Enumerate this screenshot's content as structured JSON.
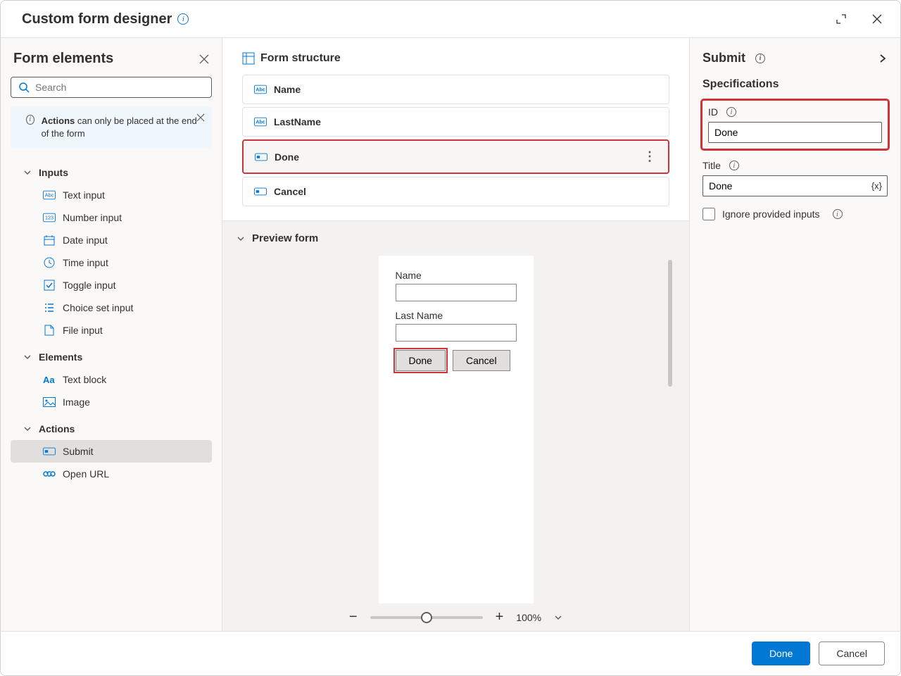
{
  "titlebar": {
    "title": "Custom form designer"
  },
  "sidebar_left": {
    "title": "Form elements",
    "search_placeholder": "Search",
    "notice_bold": "Actions",
    "notice_rest": " can only be placed at the end of the form",
    "groups": [
      {
        "label": "Inputs",
        "items": [
          {
            "label": "Text input",
            "icon": "abc"
          },
          {
            "label": "Number input",
            "icon": "123"
          },
          {
            "label": "Date input",
            "icon": "calendar"
          },
          {
            "label": "Time input",
            "icon": "clock"
          },
          {
            "label": "Toggle input",
            "icon": "check"
          },
          {
            "label": "Choice set input",
            "icon": "list"
          },
          {
            "label": "File input",
            "icon": "file"
          }
        ]
      },
      {
        "label": "Elements",
        "items": [
          {
            "label": "Text block",
            "icon": "Aa"
          },
          {
            "label": "Image",
            "icon": "image"
          }
        ]
      },
      {
        "label": "Actions",
        "items": [
          {
            "label": "Submit",
            "icon": "submit",
            "selected": true
          },
          {
            "label": "Open URL",
            "icon": "link"
          }
        ]
      }
    ]
  },
  "structure": {
    "title": "Form structure",
    "rows": [
      {
        "label": "Name",
        "icon": "abc"
      },
      {
        "label": "LastName",
        "icon": "abc"
      },
      {
        "label": "Done",
        "icon": "submit",
        "selected": true
      },
      {
        "label": "Cancel",
        "icon": "submit"
      }
    ]
  },
  "preview": {
    "title": "Preview form",
    "name_label": "Name",
    "lastname_label": "Last Name",
    "done_label": "Done",
    "cancel_label": "Cancel",
    "zoom": "100%"
  },
  "right": {
    "title": "Submit",
    "spec_title": "Specifications",
    "id_label": "ID",
    "id_value": "Done",
    "title_label": "Title",
    "title_value": "Done",
    "fx_badge": "{x}",
    "ignore_label": "Ignore provided inputs"
  },
  "footer": {
    "done": "Done",
    "cancel": "Cancel"
  },
  "icons": {
    "abc": "Abc",
    "123": "123"
  }
}
